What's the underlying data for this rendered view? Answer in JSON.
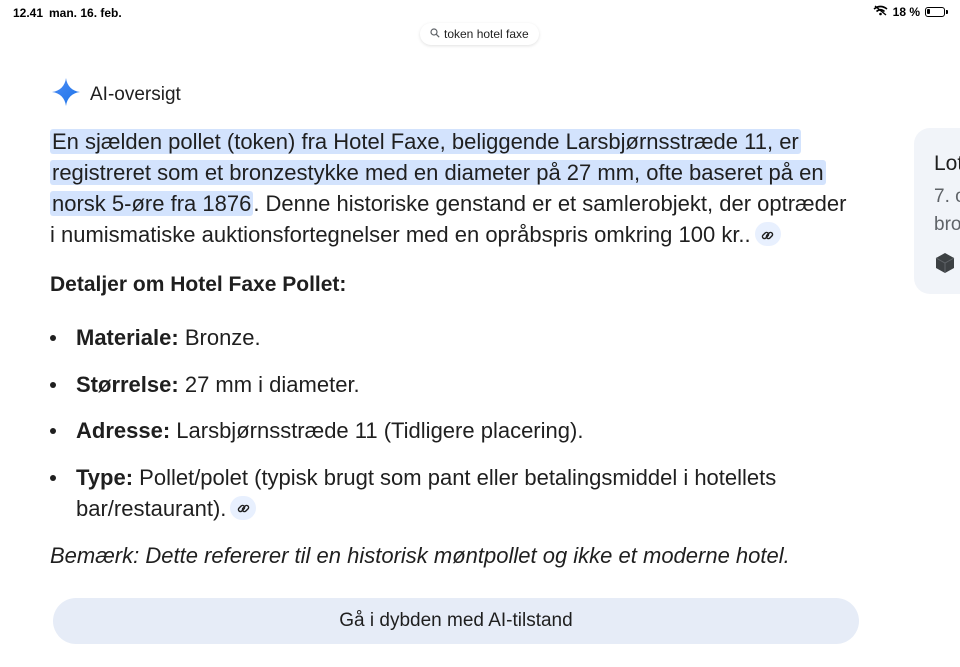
{
  "status_bar": {
    "time": "12.41",
    "date": "man. 16. feb.",
    "battery_text": "18 %",
    "icons": [
      "wifi-off-icon",
      "battery-icon"
    ]
  },
  "search": {
    "query": "token hotel faxe",
    "icon": "search-icon"
  },
  "ai_overview": {
    "icon": "sparkle-icon",
    "title": "AI-oversigt",
    "accent_color": "#4285f4",
    "highlight_color": "#d3e3fd",
    "lead_highlighted": "En sjælden pollet (token) fra Hotel Faxe, beliggende Larsbjørnsstræde 11, er registreret som et bronzestykke med en diameter på 27 mm, ofte baseret på en norsk 5-øre fra 1876",
    "lead_rest": ". Denne historiske genstand er et samlerobjekt, der optræder i numismatiske auktionsfortegnelser med en opråbspris omkring 100 kr..",
    "details_title": "Detaljer om Hotel Faxe Pollet:",
    "bullets": [
      {
        "label": "Materiale:",
        "text": " Bronze."
      },
      {
        "label": "Størrelse:",
        "text": " 27 mm i diameter."
      },
      {
        "label": "Adresse:",
        "text": " Larsbjørnsstræde 11 (Tidligere placering)."
      },
      {
        "label": "Type:",
        "text": " Pollet/polet (typisk brugt som pant eller betalingsmiddel i hotellets bar/restaurant)."
      }
    ],
    "note": "Bemærk: Dette refererer til en historisk møntpollet og ikke et moderne hotel.",
    "deep_dive_label": "Gå i dybden med AI-tilstand"
  },
  "side_card": {
    "title": "Lot",
    "line1": "7. o",
    "line2": "bro"
  }
}
